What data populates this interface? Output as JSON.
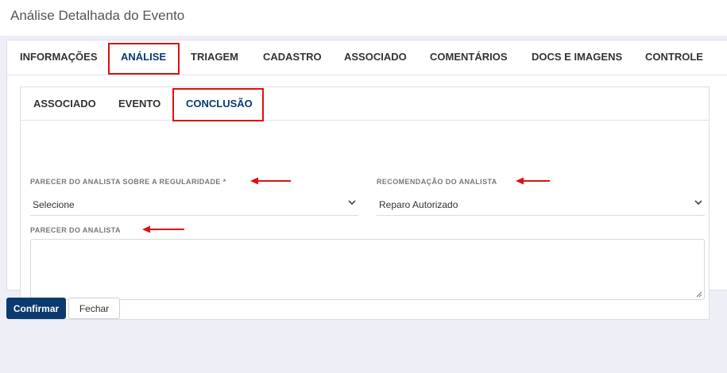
{
  "page": {
    "title": "Análise Detalhada do Evento"
  },
  "tabs": [
    {
      "label": "INFORMAÇÕES"
    },
    {
      "label": "ANÁLISE"
    },
    {
      "label": "TRIAGEM"
    },
    {
      "label": "CADASTRO"
    },
    {
      "label": "ASSOCIADO"
    },
    {
      "label": "COMENTÁRIOS"
    },
    {
      "label": "DOCS E IMAGENS"
    },
    {
      "label": "CONTROLE"
    }
  ],
  "active_tab": "ANÁLISE",
  "subtabs": [
    {
      "label": "ASSOCIADO"
    },
    {
      "label": "EVENTO"
    },
    {
      "label": "CONCLUSÃO"
    }
  ],
  "active_subtab": "CONCLUSÃO",
  "form": {
    "parecer_regularidade": {
      "label": "PARECER DO ANALISTA SOBRE A REGULARIDADE *",
      "value": "Selecione"
    },
    "recomendacao": {
      "label": "RECOMENDAÇÃO DO ANALISTA",
      "value": "Reparo Autorizado"
    },
    "parecer": {
      "label": "PARECER DO ANALISTA",
      "value": ""
    }
  },
  "buttons": {
    "confirm": "Confirmar",
    "close": "Fechar"
  },
  "colors": {
    "primary": "#0b3a6e",
    "highlight": "#e01010",
    "background": "#eeeef7"
  },
  "icons": {
    "select_chevron": "chevron-down-icon",
    "annotation": "red-arrow-icon",
    "resize": "resize-grip-icon"
  }
}
